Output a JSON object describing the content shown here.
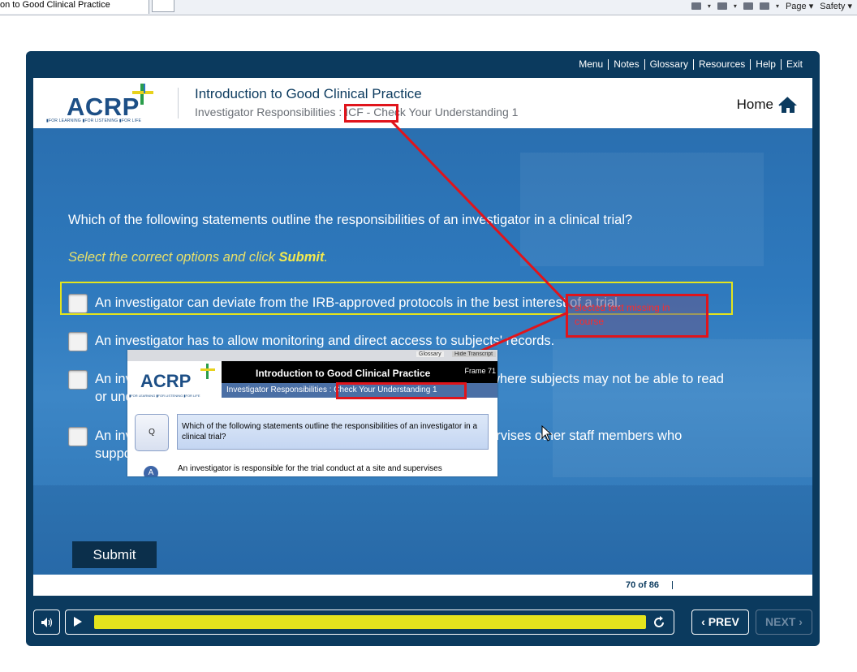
{
  "browser": {
    "tab_title": "on to Good Clinical Practice",
    "tools": [
      "Page ▾",
      "Safety ▾"
    ]
  },
  "topnav": [
    "Menu",
    "Notes",
    "Glossary",
    "Resources",
    "Help",
    "Exit"
  ],
  "header": {
    "logo": "ACRP",
    "logo_tagline": "▮FOR LEARNING ▮FOR LISTENING ▮FOR LIFE",
    "course_title": "Introduction to Good Clinical Practice",
    "subtitle": "Investigator Responsibilities : ICF - Check Your Understanding 1",
    "home_label": "Home"
  },
  "question": {
    "text": "Which of the following statements outline the responsibilities of an investigator in a clinical trial?",
    "instruction_prefix": "Select the correct options and click ",
    "instruction_bold": "Submit",
    "instruction_suffix": "."
  },
  "options": [
    {
      "label": "An investigator can deviate from the IRB-approved protocols in the best interest of a trial."
    },
    {
      "label": "An investigator has to allow monitoring and direct access to subjects' records."
    },
    {
      "label": "An investigator serves as a translator or witness for special cases, where subjects may not be able to read or understand the primary language of the site."
    },
    {
      "label": "An investigator is responsible for the trial conduct at a site and supervises other staff members who support the trial."
    }
  ],
  "submit_label": "Submit",
  "footer": {
    "page_count": "70 of 86"
  },
  "controls": {
    "prev_label": "PREV",
    "next_label": "NEXT",
    "progress_fraction": 1.0
  },
  "annotation": {
    "callout_text": "slected text missing in course"
  },
  "inset": {
    "glossary": "Glossary",
    "transcript": "Hide Transcript",
    "logo": "ACRP",
    "logo_tagline": "▮FOR LEARNING ▮FOR LISTENING ▮FOR LIFE",
    "title": "Introduction to Good Clinical Practice",
    "frame": "Frame 71",
    "subtitle": "Investigator Responsibilities : Check Your Understanding 1",
    "q_label": "Q",
    "question": "Which of the following statements outline the responsibilities of an investigator in a clinical trial?",
    "a_label": "A",
    "answer": "An investigator is responsible for the trial conduct at a site and supervises"
  },
  "colors": {
    "frame": "#0b3a5e",
    "accent_yellow": "#e4e41d",
    "annotation_red": "#e0141b"
  }
}
